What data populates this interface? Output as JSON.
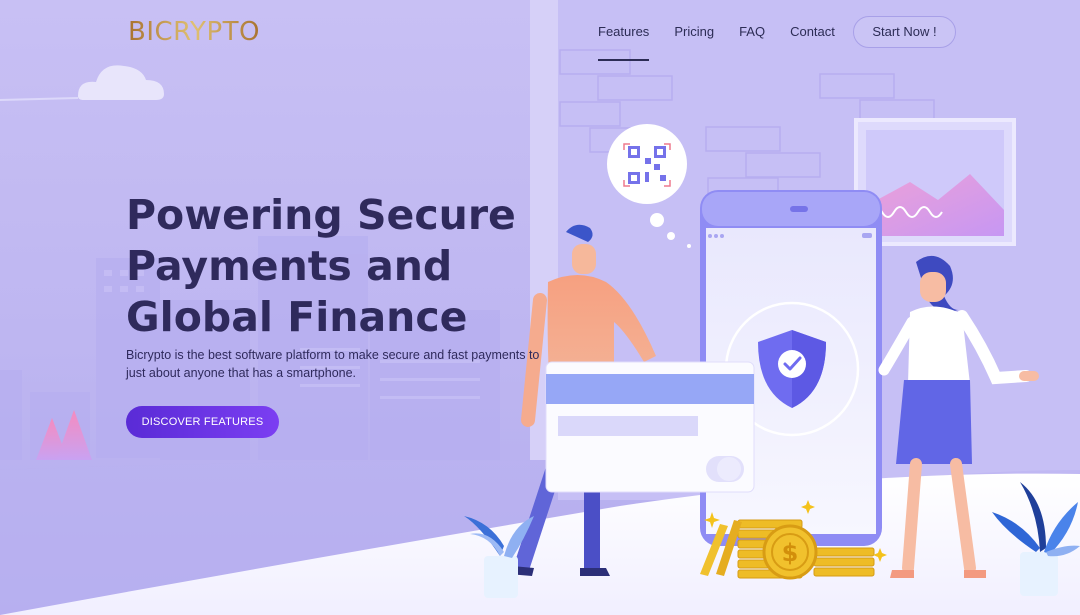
{
  "brand": {
    "name": "BICRYPTO"
  },
  "nav": {
    "items": [
      {
        "label": "Features",
        "active": true
      },
      {
        "label": "Pricing",
        "active": false
      },
      {
        "label": "FAQ",
        "active": false
      },
      {
        "label": "Contact",
        "active": false
      }
    ],
    "cta_label": "Start Now !"
  },
  "hero": {
    "title_lines": [
      "Powering Secure",
      "Payments and",
      "Global Finance"
    ],
    "description": "Bicrypto is the best software platform to make secure and fast payments to just about anyone that has a smartphone.",
    "button_label": "DISCOVER FEATURES"
  },
  "illustration": {
    "icons": [
      "qr-code-icon",
      "shield-check-icon",
      "dollar-coin-icon",
      "credit-card-icon",
      "smartphone-icon",
      "cloud-icon",
      "plant-icon"
    ],
    "coin_symbol": "$"
  },
  "colors": {
    "background": "#c8c0f4",
    "title": "#2f2a5c",
    "accent": "#5a2bd6",
    "gold": "#e9b521"
  }
}
